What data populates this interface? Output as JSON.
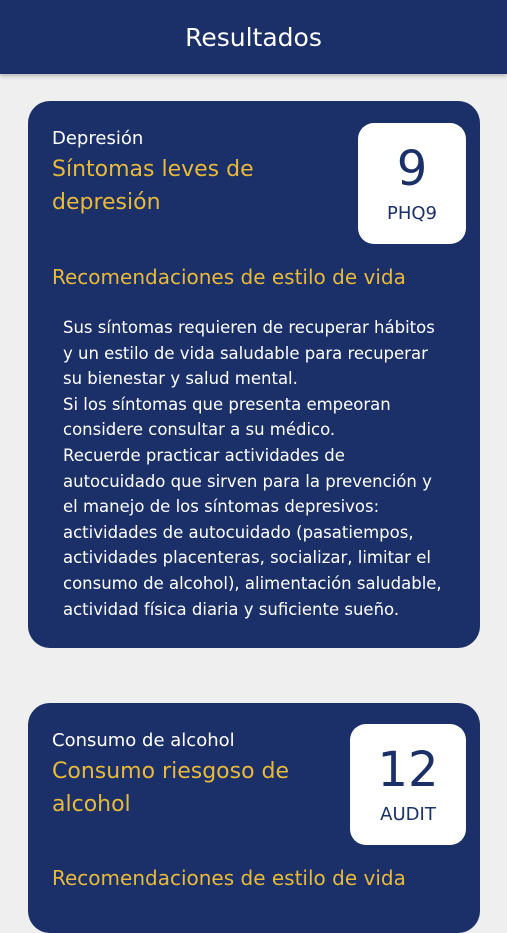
{
  "header": {
    "title": "Resultados"
  },
  "cards": [
    {
      "category": "Depresión",
      "severity": "Síntomas leves de depresión",
      "score": "9",
      "scale": "PHQ9",
      "recommendations_title": "Recomendaciones de estilo de vida",
      "recommendations_lines": [
        "Sus síntomas requieren de recuperar hábitos",
        "y un estilo de vida saludable para recuperar",
        "su bienestar y salud mental.",
        "Si los síntomas que presenta empeoran",
        "considere consultar a su médico.",
        "Recuerde practicar actividades de",
        "autocuidado que sirven para la prevención y",
        "el manejo de los síntomas depresivos:",
        "actividades de autocuidado (pasatiempos,",
        "actividades placenteras, socializar, limitar el",
        "consumo de alcohol), alimentación saludable,",
        "actividad física diaria y suficiente sueño."
      ]
    },
    {
      "category": "Consumo de alcohol",
      "severity": "Consumo riesgoso de alcohol",
      "score": "12",
      "scale": "AUDIT",
      "recommendations_title": "Recomendaciones de estilo de vida"
    }
  ]
}
